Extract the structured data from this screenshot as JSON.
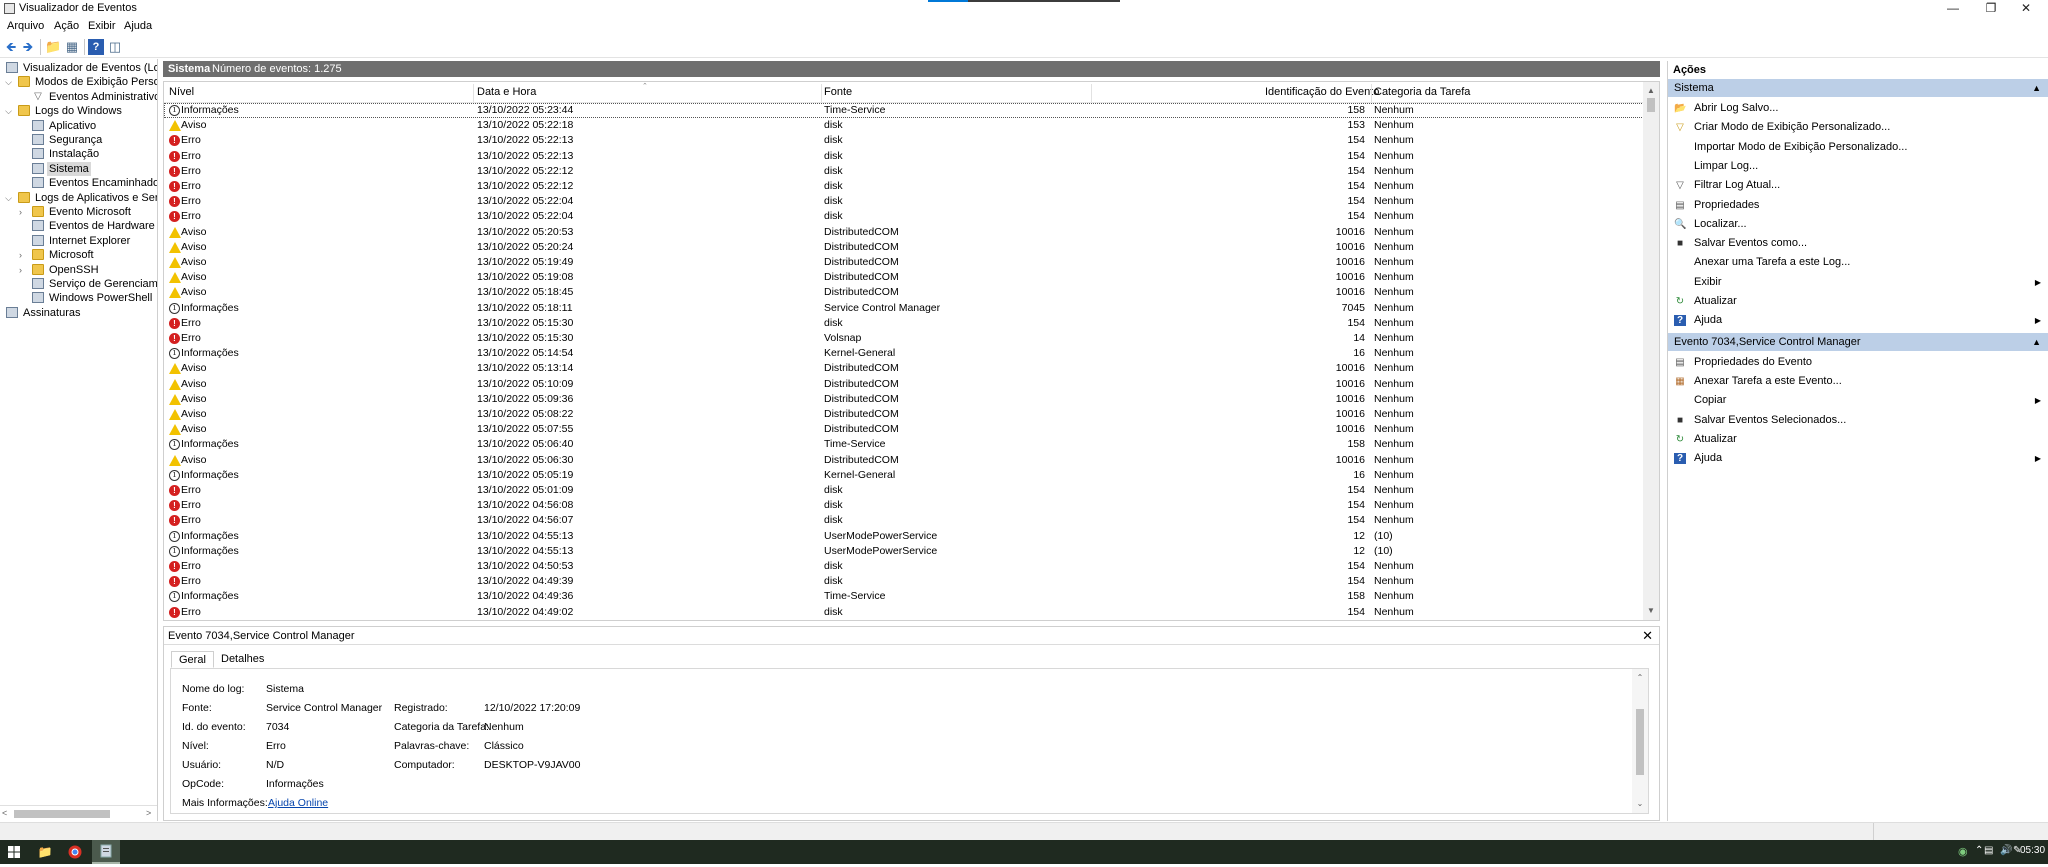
{
  "window": {
    "title": "Visualizador de Eventos"
  },
  "menu": [
    "Arquivo",
    "Ação",
    "Exibir",
    "Ajuda"
  ],
  "tree": [
    {
      "label": "Visualizador de Eventos (Local)",
      "level": 0,
      "toggle": "",
      "icon": "log"
    },
    {
      "label": "Modos de Exibição Personalizados",
      "level": 0,
      "toggle": "v",
      "icon": "folder"
    },
    {
      "label": "Eventos Administrativos",
      "level": 1,
      "toggle": "",
      "icon": "filter"
    },
    {
      "label": "Logs do Windows",
      "level": 0,
      "toggle": "v",
      "icon": "folder"
    },
    {
      "label": "Aplicativo",
      "level": 1,
      "toggle": "",
      "icon": "log"
    },
    {
      "label": "Segurança",
      "level": 1,
      "toggle": "",
      "icon": "log"
    },
    {
      "label": "Instalação",
      "level": 1,
      "toggle": "",
      "icon": "log"
    },
    {
      "label": "Sistema",
      "level": 1,
      "toggle": "",
      "icon": "log",
      "selected": true
    },
    {
      "label": "Eventos Encaminhados",
      "level": 1,
      "toggle": "",
      "icon": "log"
    },
    {
      "label": "Logs de Aplicativos e Serviços",
      "level": 0,
      "toggle": "v",
      "icon": "folder"
    },
    {
      "label": "Evento Microsoft",
      "level": 1,
      "toggle": ">",
      "icon": "folder"
    },
    {
      "label": "Eventos de Hardware",
      "level": 1,
      "toggle": "",
      "icon": "log"
    },
    {
      "label": "Internet Explorer",
      "level": 1,
      "toggle": "",
      "icon": "log"
    },
    {
      "label": "Microsoft",
      "level": 1,
      "toggle": ">",
      "icon": "folder"
    },
    {
      "label": "OpenSSH",
      "level": 1,
      "toggle": ">",
      "icon": "folder"
    },
    {
      "label": "Serviço de Gerenciamento",
      "level": 1,
      "toggle": "",
      "icon": "log"
    },
    {
      "label": "Windows PowerShell",
      "level": 1,
      "toggle": "",
      "icon": "log"
    },
    {
      "label": "Assinaturas",
      "level": 0,
      "toggle": "",
      "icon": "log"
    }
  ],
  "log_header": {
    "name": "Sistema",
    "count": "Número de eventos: 1.275"
  },
  "columns": [
    "Nível",
    "Data e Hora",
    "Fonte",
    "Identificação do Evento",
    "Categoria da Tarefa"
  ],
  "events": [
    {
      "level": "Informações",
      "type": "info",
      "date": "13/10/2022 05:23:44",
      "source": "Time-Service",
      "id": "158",
      "category": "Nenhum",
      "selected": true
    },
    {
      "level": "Aviso",
      "type": "warn",
      "date": "13/10/2022 05:22:18",
      "source": "disk",
      "id": "153",
      "category": "Nenhum"
    },
    {
      "level": "Erro",
      "type": "err",
      "date": "13/10/2022 05:22:13",
      "source": "disk",
      "id": "154",
      "category": "Nenhum"
    },
    {
      "level": "Erro",
      "type": "err",
      "date": "13/10/2022 05:22:13",
      "source": "disk",
      "id": "154",
      "category": "Nenhum"
    },
    {
      "level": "Erro",
      "type": "err",
      "date": "13/10/2022 05:22:12",
      "source": "disk",
      "id": "154",
      "category": "Nenhum"
    },
    {
      "level": "Erro",
      "type": "err",
      "date": "13/10/2022 05:22:12",
      "source": "disk",
      "id": "154",
      "category": "Nenhum"
    },
    {
      "level": "Erro",
      "type": "err",
      "date": "13/10/2022 05:22:04",
      "source": "disk",
      "id": "154",
      "category": "Nenhum"
    },
    {
      "level": "Erro",
      "type": "err",
      "date": "13/10/2022 05:22:04",
      "source": "disk",
      "id": "154",
      "category": "Nenhum"
    },
    {
      "level": "Aviso",
      "type": "warn",
      "date": "13/10/2022 05:20:53",
      "source": "DistributedCOM",
      "id": "10016",
      "category": "Nenhum"
    },
    {
      "level": "Aviso",
      "type": "warn",
      "date": "13/10/2022 05:20:24",
      "source": "DistributedCOM",
      "id": "10016",
      "category": "Nenhum"
    },
    {
      "level": "Aviso",
      "type": "warn",
      "date": "13/10/2022 05:19:49",
      "source": "DistributedCOM",
      "id": "10016",
      "category": "Nenhum"
    },
    {
      "level": "Aviso",
      "type": "warn",
      "date": "13/10/2022 05:19:08",
      "source": "DistributedCOM",
      "id": "10016",
      "category": "Nenhum"
    },
    {
      "level": "Aviso",
      "type": "warn",
      "date": "13/10/2022 05:18:45",
      "source": "DistributedCOM",
      "id": "10016",
      "category": "Nenhum"
    },
    {
      "level": "Informações",
      "type": "info",
      "date": "13/10/2022 05:18:11",
      "source": "Service Control Manager",
      "id": "7045",
      "category": "Nenhum"
    },
    {
      "level": "Erro",
      "type": "err",
      "date": "13/10/2022 05:15:30",
      "source": "disk",
      "id": "154",
      "category": "Nenhum"
    },
    {
      "level": "Erro",
      "type": "err",
      "date": "13/10/2022 05:15:30",
      "source": "Volsnap",
      "id": "14",
      "category": "Nenhum"
    },
    {
      "level": "Informações",
      "type": "info",
      "date": "13/10/2022 05:14:54",
      "source": "Kernel-General",
      "id": "16",
      "category": "Nenhum"
    },
    {
      "level": "Aviso",
      "type": "warn",
      "date": "13/10/2022 05:13:14",
      "source": "DistributedCOM",
      "id": "10016",
      "category": "Nenhum"
    },
    {
      "level": "Aviso",
      "type": "warn",
      "date": "13/10/2022 05:10:09",
      "source": "DistributedCOM",
      "id": "10016",
      "category": "Nenhum"
    },
    {
      "level": "Aviso",
      "type": "warn",
      "date": "13/10/2022 05:09:36",
      "source": "DistributedCOM",
      "id": "10016",
      "category": "Nenhum"
    },
    {
      "level": "Aviso",
      "type": "warn",
      "date": "13/10/2022 05:08:22",
      "source": "DistributedCOM",
      "id": "10016",
      "category": "Nenhum"
    },
    {
      "level": "Aviso",
      "type": "warn",
      "date": "13/10/2022 05:07:55",
      "source": "DistributedCOM",
      "id": "10016",
      "category": "Nenhum"
    },
    {
      "level": "Informações",
      "type": "info",
      "date": "13/10/2022 05:06:40",
      "source": "Time-Service",
      "id": "158",
      "category": "Nenhum"
    },
    {
      "level": "Aviso",
      "type": "warn",
      "date": "13/10/2022 05:06:30",
      "source": "DistributedCOM",
      "id": "10016",
      "category": "Nenhum"
    },
    {
      "level": "Informações",
      "type": "info",
      "date": "13/10/2022 05:05:19",
      "source": "Kernel-General",
      "id": "16",
      "category": "Nenhum"
    },
    {
      "level": "Erro",
      "type": "err",
      "date": "13/10/2022 05:01:09",
      "source": "disk",
      "id": "154",
      "category": "Nenhum"
    },
    {
      "level": "Erro",
      "type": "err",
      "date": "13/10/2022 04:56:08",
      "source": "disk",
      "id": "154",
      "category": "Nenhum"
    },
    {
      "level": "Erro",
      "type": "err",
      "date": "13/10/2022 04:56:07",
      "source": "disk",
      "id": "154",
      "category": "Nenhum"
    },
    {
      "level": "Informações",
      "type": "info",
      "date": "13/10/2022 04:55:13",
      "source": "UserModePowerService",
      "id": "12",
      "category": "(10)"
    },
    {
      "level": "Informações",
      "type": "info",
      "date": "13/10/2022 04:55:13",
      "source": "UserModePowerService",
      "id": "12",
      "category": "(10)"
    },
    {
      "level": "Erro",
      "type": "err",
      "date": "13/10/2022 04:50:53",
      "source": "disk",
      "id": "154",
      "category": "Nenhum"
    },
    {
      "level": "Erro",
      "type": "err",
      "date": "13/10/2022 04:49:39",
      "source": "disk",
      "id": "154",
      "category": "Nenhum"
    },
    {
      "level": "Informações",
      "type": "info",
      "date": "13/10/2022 04:49:36",
      "source": "Time-Service",
      "id": "158",
      "category": "Nenhum"
    },
    {
      "level": "Erro",
      "type": "err",
      "date": "13/10/2022 04:49:02",
      "source": "disk",
      "id": "154",
      "category": "Nenhum"
    }
  ],
  "detail": {
    "title": "Evento 7034,Service Control Manager",
    "tabs": [
      "Geral",
      "Detalhes"
    ],
    "fields": {
      "log_name_label": "Nome do log:",
      "log_name": "Sistema",
      "source_label": "Fonte:",
      "source": "Service Control Manager",
      "logged_label": "Registrado:",
      "logged": "12/10/2022 17:20:09",
      "event_id_label": "Id. do evento:",
      "event_id": "7034",
      "task_label": "Categoria da Tarefa:",
      "task": "Nenhum",
      "level_label": "Nível:",
      "level": "Erro",
      "keywords_label": "Palavras-chave:",
      "keywords": "Clássico",
      "user_label": "Usuário:",
      "user": "N/D",
      "computer_label": "Computador:",
      "computer": "DESKTOP-V9JAV00",
      "opcode_label": "OpCode:",
      "opcode": "Informações",
      "more_label": "Mais Informações:",
      "more_link": "Ajuda Online"
    }
  },
  "actions": {
    "title": "Ações",
    "sections": [
      {
        "name": "Sistema",
        "items": [
          {
            "label": "Abrir Log Salvo...",
            "icon": "open-log-icon"
          },
          {
            "label": "Criar Modo de Exibição Personalizado...",
            "icon": "create-view-icon"
          },
          {
            "label": "Importar Modo de Exibição Personalizado...",
            "icon": ""
          },
          {
            "label": "Limpar Log...",
            "icon": ""
          },
          {
            "label": "Filtrar Log Atual...",
            "icon": "filter-icon"
          },
          {
            "label": "Propriedades",
            "icon": "properties-icon"
          },
          {
            "label": "Localizar...",
            "icon": "find-icon"
          },
          {
            "label": "Salvar Eventos como...",
            "icon": "save-icon"
          },
          {
            "label": "Anexar uma Tarefa a este Log...",
            "icon": ""
          },
          {
            "label": "Exibir",
            "icon": "",
            "submenu": true
          },
          {
            "label": "Atualizar",
            "icon": "refresh-icon"
          },
          {
            "label": "Ajuda",
            "icon": "help-icon",
            "submenu": true
          }
        ]
      },
      {
        "name": "Evento 7034,Service Control Manager",
        "items": [
          {
            "label": "Propriedades do Evento",
            "icon": "event-properties-icon"
          },
          {
            "label": "Anexar Tarefa a este Evento...",
            "icon": "attach-task-icon"
          },
          {
            "label": "Copiar",
            "icon": "",
            "submenu": true
          },
          {
            "label": "Salvar Eventos Selecionados...",
            "icon": "save-icon"
          },
          {
            "label": "Atualizar",
            "icon": "refresh-icon"
          },
          {
            "label": "Ajuda",
            "icon": "help-icon",
            "submenu": true
          }
        ]
      }
    ]
  },
  "taskbar": {
    "clock": "05:30"
  }
}
